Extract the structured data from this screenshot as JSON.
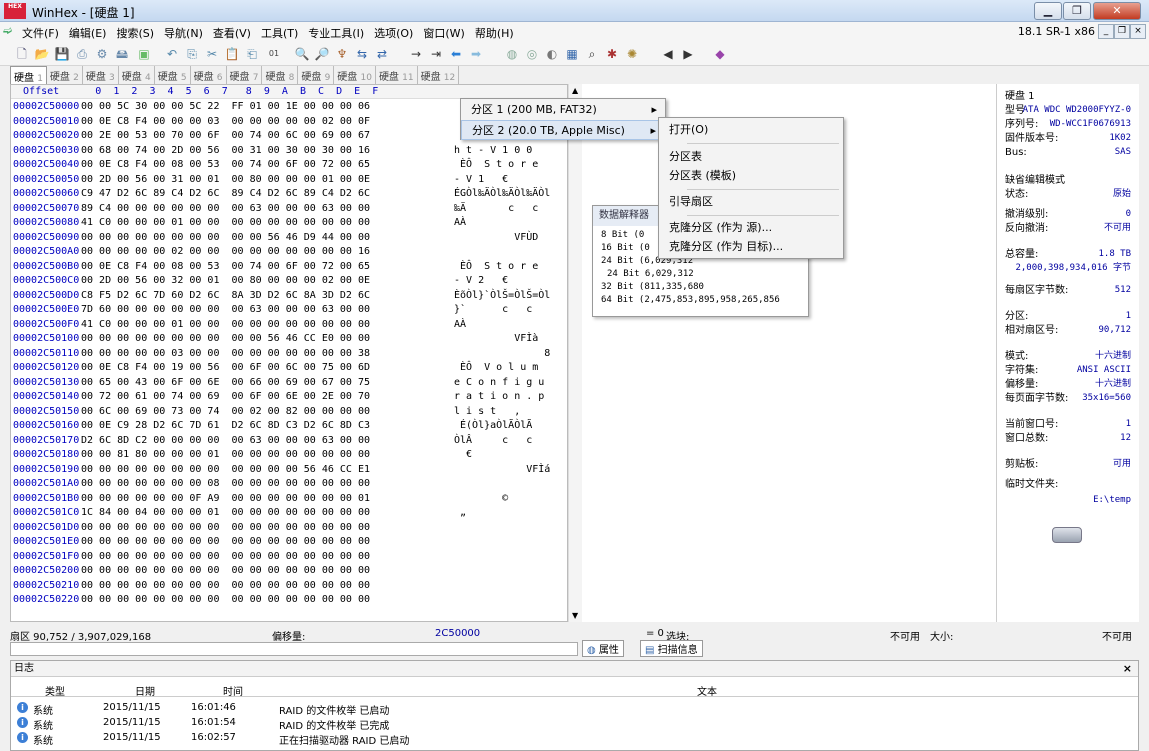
{
  "window": {
    "title": "WinHex - [硬盘 1]",
    "app_icon": "HEX"
  },
  "menu": {
    "items": [
      "文件(F)",
      "编辑(E)",
      "搜索(S)",
      "导航(N)",
      "查看(V)",
      "工具(T)",
      "专业工具(I)",
      "选项(O)",
      "窗口(W)",
      "帮助(H)"
    ],
    "version": "18.1 SR-1 x86"
  },
  "tabs": [
    {
      "label": "硬盘",
      "num": "1"
    },
    {
      "label": "硬盘",
      "num": "2"
    },
    {
      "label": "硬盘",
      "num": "3"
    },
    {
      "label": "硬盘",
      "num": "4"
    },
    {
      "label": "硬盘",
      "num": "5"
    },
    {
      "label": "硬盘",
      "num": "6"
    },
    {
      "label": "硬盘",
      "num": "7"
    },
    {
      "label": "硬盘",
      "num": "8"
    },
    {
      "label": "硬盘",
      "num": "9"
    },
    {
      "label": "硬盘",
      "num": "10"
    },
    {
      "label": "硬盘",
      "num": "11"
    },
    {
      "label": "硬盘",
      "num": "12"
    }
  ],
  "hex": {
    "header": "  Offset      0  1  2  3  4  5  6  7   8  9  A  B  C  D  E  F",
    "rows": [
      {
        "off": "00002C50000",
        "hex": "00 00 5C 30 00 00 5C 22  FF 01 00 1E 00 00 00 06",
        "txt": ""
      },
      {
        "off": "00002C50010",
        "hex": "00 0E C8 F4 00 00 00 03  00 00 00 00 00 02 00 0F",
        "txt": ""
      },
      {
        "off": "00002C50020",
        "hex": "00 2E 00 53 00 70 00 6F  00 74 00 6C 00 69 00 67",
        "txt": ""
      },
      {
        "off": "00002C50030",
        "hex": "00 68 00 74 00 2D 00 56  00 31 00 30 00 30 00 16",
        "txt": "h t - V 1 0 0"
      },
      {
        "off": "00002C50040",
        "hex": "00 0E C8 F4 00 08 00 53  00 74 00 6F 00 72 00 65",
        "txt": " ÈÔ  S t o r e"
      },
      {
        "off": "00002C50050",
        "hex": "00 2D 00 56 00 31 00 01  00 80 00 00 00 01 00 0E",
        "txt": "- V 1   €"
      },
      {
        "off": "00002C50060",
        "hex": "C9 47 D2 6C 89 C4 D2 6C  89 C4 D2 6C 89 C4 D2 6C",
        "txt": "ÉGÒl‰ÄÒl‰ÄÒl‰ÄÒl"
      },
      {
        "off": "00002C50070",
        "hex": "89 C4 00 00 00 00 00 00  00 63 00 00 00 63 00 00",
        "txt": "‰Ä       c   c"
      },
      {
        "off": "00002C50080",
        "hex": "41 C0 00 00 00 01 00 00  00 00 00 00 00 00 00 00",
        "txt": "AÀ"
      },
      {
        "off": "00002C50090",
        "hex": "00 00 00 00 00 00 00 00  00 00 56 46 D9 44 00 00",
        "txt": "          VFÙD"
      },
      {
        "off": "00002C500A0",
        "hex": "00 00 00 00 00 02 00 00  00 00 00 00 00 00 00 16",
        "txt": ""
      },
      {
        "off": "00002C500B0",
        "hex": "00 0E C8 F4 00 08 00 53  00 74 00 6F 00 72 00 65",
        "txt": " ÈÔ  S t o r e"
      },
      {
        "off": "00002C500C0",
        "hex": "00 2D 00 56 00 32 00 01  00 80 00 00 00 02 00 0E",
        "txt": "- V 2   €"
      },
      {
        "off": "00002C500D0",
        "hex": "C8 F5 D2 6C 7D 60 D2 6C  8A 3D D2 6C 8A 3D D2 6C",
        "txt": "ÈõÒl}`ÒlŠ=ÒlŠ=Òl"
      },
      {
        "off": "00002C500E0",
        "hex": "7D 60 00 00 00 00 00 00  00 63 00 00 00 63 00 00",
        "txt": "}`      c   c"
      },
      {
        "off": "00002C500F0",
        "hex": "41 C0 00 00 00 01 00 00  00 00 00 00 00 00 00 00",
        "txt": "AÀ"
      },
      {
        "off": "00002C50100",
        "hex": "00 00 00 00 00 00 00 00  00 00 56 46 CC E0 00 00",
        "txt": "          VFÌà"
      },
      {
        "off": "00002C50110",
        "hex": "00 00 00 00 00 03 00 00  00 00 00 00 00 00 00 38",
        "txt": "               8"
      },
      {
        "off": "00002C50120",
        "hex": "00 0E C8 F4 00 19 00 56  00 6F 00 6C 00 75 00 6D",
        "txt": " ÈÔ  V o l u m"
      },
      {
        "off": "00002C50130",
        "hex": "00 65 00 43 00 6F 00 6E  00 66 00 69 00 67 00 75",
        "txt": "e C o n f i g u"
      },
      {
        "off": "00002C50140",
        "hex": "00 72 00 61 00 74 00 69  00 6F 00 6E 00 2E 00 70",
        "txt": "r a t i o n . p"
      },
      {
        "off": "00002C50150",
        "hex": "00 6C 00 69 00 73 00 74  00 02 00 82 00 00 00 00",
        "txt": "l i s t   ‚"
      },
      {
        "off": "00002C50160",
        "hex": "00 0E C9 28 D2 6C 7D 61  D2 6C 8D C3 D2 6C 8D C3",
        "txt": " É(Òl}aÒlÃÒlÃ"
      },
      {
        "off": "00002C50170",
        "hex": "D2 6C 8D C2 00 00 00 00  00 63 00 00 00 63 00 00",
        "txt": "ÒlÂ     c   c"
      },
      {
        "off": "00002C50180",
        "hex": "00 00 81 80 00 00 00 01  00 00 00 00 00 00 00 00",
        "txt": "  €"
      },
      {
        "off": "00002C50190",
        "hex": "00 00 00 00 00 00 00 00  00 00 00 00 56 46 CC E1",
        "txt": "            VFÌá"
      },
      {
        "off": "00002C501A0",
        "hex": "00 00 00 00 00 00 00 08  00 00 00 00 00 00 00 00",
        "txt": ""
      },
      {
        "off": "00002C501B0",
        "hex": "00 00 00 00 00 00 0F A9  00 00 00 00 00 00 00 01",
        "txt": "        ©"
      },
      {
        "off": "00002C501C0",
        "hex": "1C 84 00 04 00 00 00 01  00 00 00 00 00 00 00 00",
        "txt": " „"
      },
      {
        "off": "00002C501D0",
        "hex": "00 00 00 00 00 00 00 00  00 00 00 00 00 00 00 00",
        "txt": ""
      },
      {
        "off": "00002C501E0",
        "hex": "00 00 00 00 00 00 00 00  00 00 00 00 00 00 00 00",
        "txt": ""
      },
      {
        "off": "00002C501F0",
        "hex": "00 00 00 00 00 00 00 00  00 00 00 00 00 00 00 00",
        "txt": ""
      },
      {
        "off": "00002C50200",
        "hex": "00 00 00 00 00 00 00 00  00 00 00 00 00 00 00 00",
        "txt": ""
      },
      {
        "off": "00002C50210",
        "hex": "00 00 00 00 00 00 00 00  00 00 00 00 00 00 00 00",
        "txt": ""
      },
      {
        "off": "00002C50220",
        "hex": "00 00 00 00 00 00 00 00  00 00 00 00 00 00 00 00",
        "txt": ""
      }
    ]
  },
  "context_menu": {
    "items": [
      {
        "label": "分区 1 (200 MB, FAT32)"
      },
      {
        "label": "分区 2 (20.0 TB, Apple Misc)"
      }
    ]
  },
  "submenu": {
    "open": "打开(O)",
    "ptable": "分区表",
    "ptable_tpl": "分区表 (模板)",
    "boot": "引导扇区",
    "clone_src": "克隆分区 (作为 源)...",
    "clone_dst": "克隆分区 (作为 目标)..."
  },
  "data_interpreter": {
    "title": "数据解释器",
    "rows": [
      "8 Bit (0",
      "16 Bit (0",
      "24 Bit (6,029,312",
      "24 Bit 6,029,312",
      "32 Bit (811,335,680",
      "64 Bit (2,475,853,895,958,265,856"
    ]
  },
  "info": {
    "disk_title": "硬盘 1",
    "model_l": "型号",
    "model_v": "ATA WDC WD2000FYYZ-0",
    "serial_l": "序列号:",
    "serial_v": "WD-WCC1F0676913",
    "fw_l": "固件版本号:",
    "fw_v": "1K02",
    "bus_l": "Bus:",
    "bus_v": "SAS",
    "editmode_l": "缺省编辑模式",
    "state_l": "状态:",
    "state_v": "原始",
    "undo_l": "撤消级别:",
    "undo_v": "0",
    "revundo_l": "反向撤消:",
    "revundo_v": "不可用",
    "cap_l": "总容量:",
    "cap_v": "1.8 TB",
    "cap_bytes_v": "2,000,398,934,016 字节",
    "bps_l": "每扇区字节数:",
    "bps_v": "512",
    "part_l": "分区:",
    "part_v": "1",
    "relsec_l": "相对扇区号:",
    "relsec_v": "90,712",
    "mode_l": "模式:",
    "mode_v": "十六进制",
    "charset_l": "字符集:",
    "charset_v": "ANSI ASCII",
    "offsets_l": "偏移量:",
    "offsets_v": "十六进制",
    "bpp_l": "每页面字节数:",
    "bpp_v": "35x16=560",
    "curwin_l": "当前窗口号:",
    "curwin_v": "1",
    "totwin_l": "窗口总数:",
    "totwin_v": "12",
    "clip_l": "剪贴板:",
    "clip_v": "可用",
    "temp_l": "临时文件夹:",
    "temp_v": "E:\\temp"
  },
  "status": {
    "sector": "扇区 90,752 / 3,907,029,168",
    "offset_l": "偏移量:",
    "offset_v": "2C50000",
    "eq": "= 0",
    "sel_l": "选块:",
    "sel_v": "不可用",
    "size_l": "大小:",
    "size_v": "不可用"
  },
  "infotabs": {
    "props": "属性",
    "scan": "扫描信息"
  },
  "log": {
    "title": "日志",
    "close": "×",
    "cols": {
      "type": "类型",
      "date": "日期",
      "time": "时间",
      "text": "文本"
    },
    "rows": [
      {
        "type": "系统",
        "date": "2015/11/15",
        "time": "16:01:46",
        "text": "RAID 的文件枚举 已启动"
      },
      {
        "type": "系统",
        "date": "2015/11/15",
        "time": "16:01:54",
        "text": "RAID 的文件枚举 已完成"
      },
      {
        "type": "系统",
        "date": "2015/11/15",
        "time": "16:02:57",
        "text": "正在扫描驱动器 RAID 已启动"
      }
    ]
  }
}
